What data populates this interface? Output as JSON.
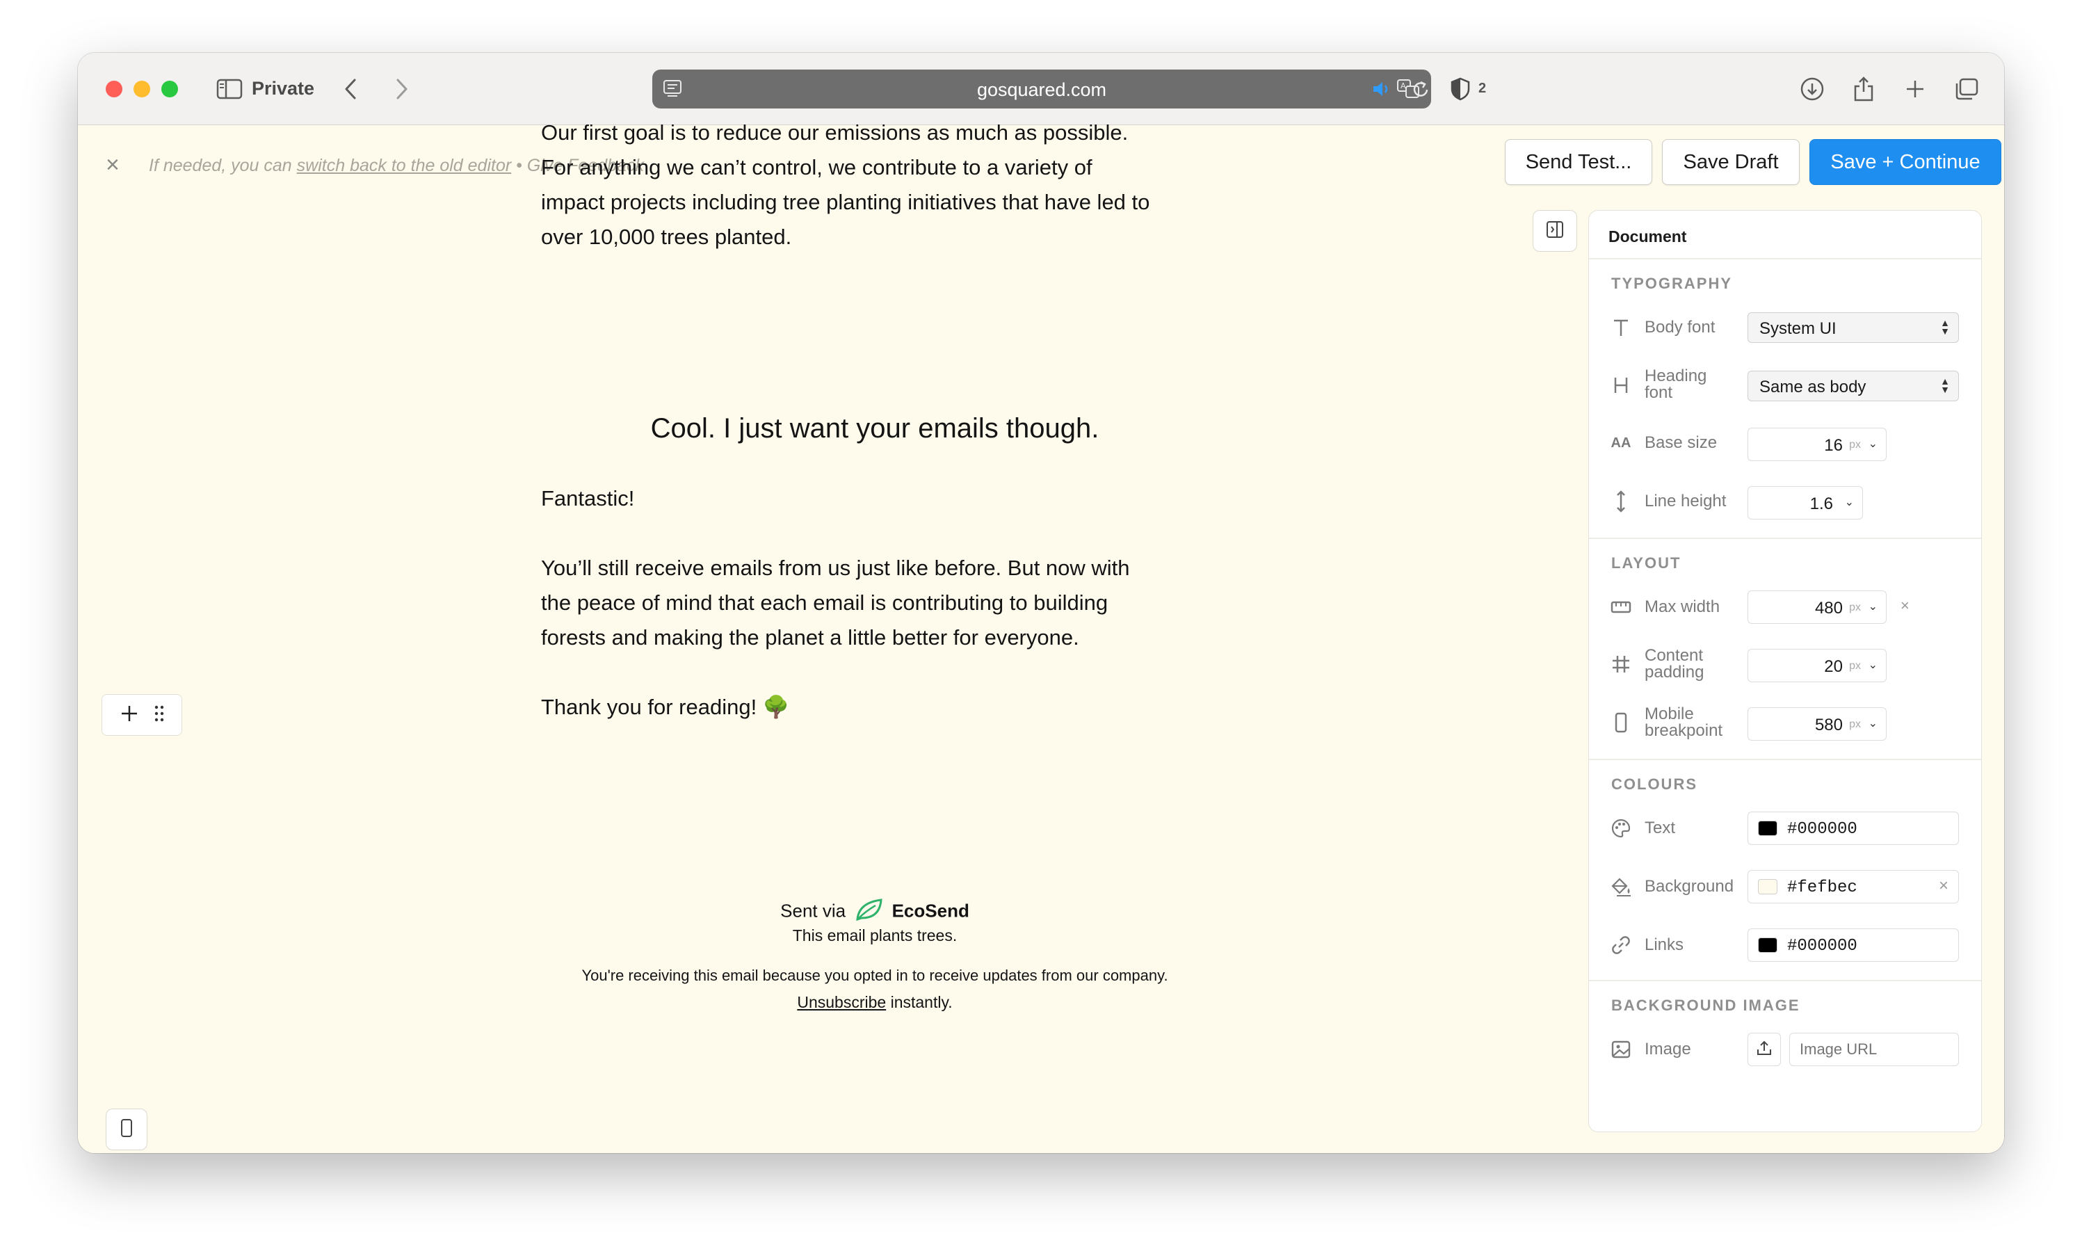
{
  "browser": {
    "private_label": "Private",
    "url": "gosquared.com",
    "shield_count": "2"
  },
  "notice": {
    "prefix": "If needed, you can ",
    "link": "switch back to the old editor",
    "suffix": " • Give Feedback"
  },
  "actions": {
    "send_test": "Send Test...",
    "save_draft": "Save Draft",
    "save_continue": "Save + Continue"
  },
  "email": {
    "para1_lines": [
      "Our first goal is to reduce our emissions as much as possible.",
      "For anything we can’t control, we contribute to a variety of",
      "impact projects including tree planting initiatives that have led to",
      "over 10,000 trees planted."
    ],
    "heading": "Cool. I just want your emails though.",
    "fantastic": "Fantastic!",
    "para2_lines": [
      "You’ll still receive emails from us just like before. But now with",
      "the peace of mind that each email is contributing to building",
      "forests and making the planet a little better for everyone."
    ],
    "thanks": "Thank you for reading! 🌳",
    "footer": {
      "sent_via": "Sent via",
      "brand": "EcoSend",
      "plants": "This email plants trees.",
      "receiving": "You're receiving this email because you opted in to receive updates from our company.",
      "unsubscribe": "Unsubscribe",
      "instantly": " instantly."
    }
  },
  "panel": {
    "title": "Document",
    "typography": {
      "title": "TYPOGRAPHY",
      "body_font_label": "Body font",
      "body_font_value": "System UI",
      "heading_font_label_1": "Heading",
      "heading_font_label_2": "font",
      "heading_font_value": "Same as body",
      "base_size_label": "Base size",
      "base_size_value": "16",
      "base_size_unit": "px",
      "line_height_label": "Line height",
      "line_height_value": "1.6"
    },
    "layout": {
      "title": "LAYOUT",
      "max_width_label": "Max width",
      "max_width_value": "480",
      "max_width_unit": "px",
      "content_padding_label_1": "Content",
      "content_padding_label_2": "padding",
      "content_padding_value": "20",
      "content_padding_unit": "px",
      "mobile_breakpoint_label_1": "Mobile",
      "mobile_breakpoint_label_2": "breakpoint",
      "mobile_breakpoint_value": "580",
      "mobile_breakpoint_unit": "px"
    },
    "colours": {
      "title": "COLOURS",
      "text_label": "Text",
      "text_value": "#000000",
      "background_label": "Background",
      "background_value": "#fefbec",
      "links_label": "Links",
      "links_value": "#000000"
    },
    "background_image": {
      "title": "BACKGROUND IMAGE",
      "image_label": "Image",
      "url_placeholder": "Image URL"
    }
  },
  "colors": {
    "accent": "#1f8ef1",
    "canvas_bg": "#fefbec",
    "brand_green": "#2fb36b"
  }
}
